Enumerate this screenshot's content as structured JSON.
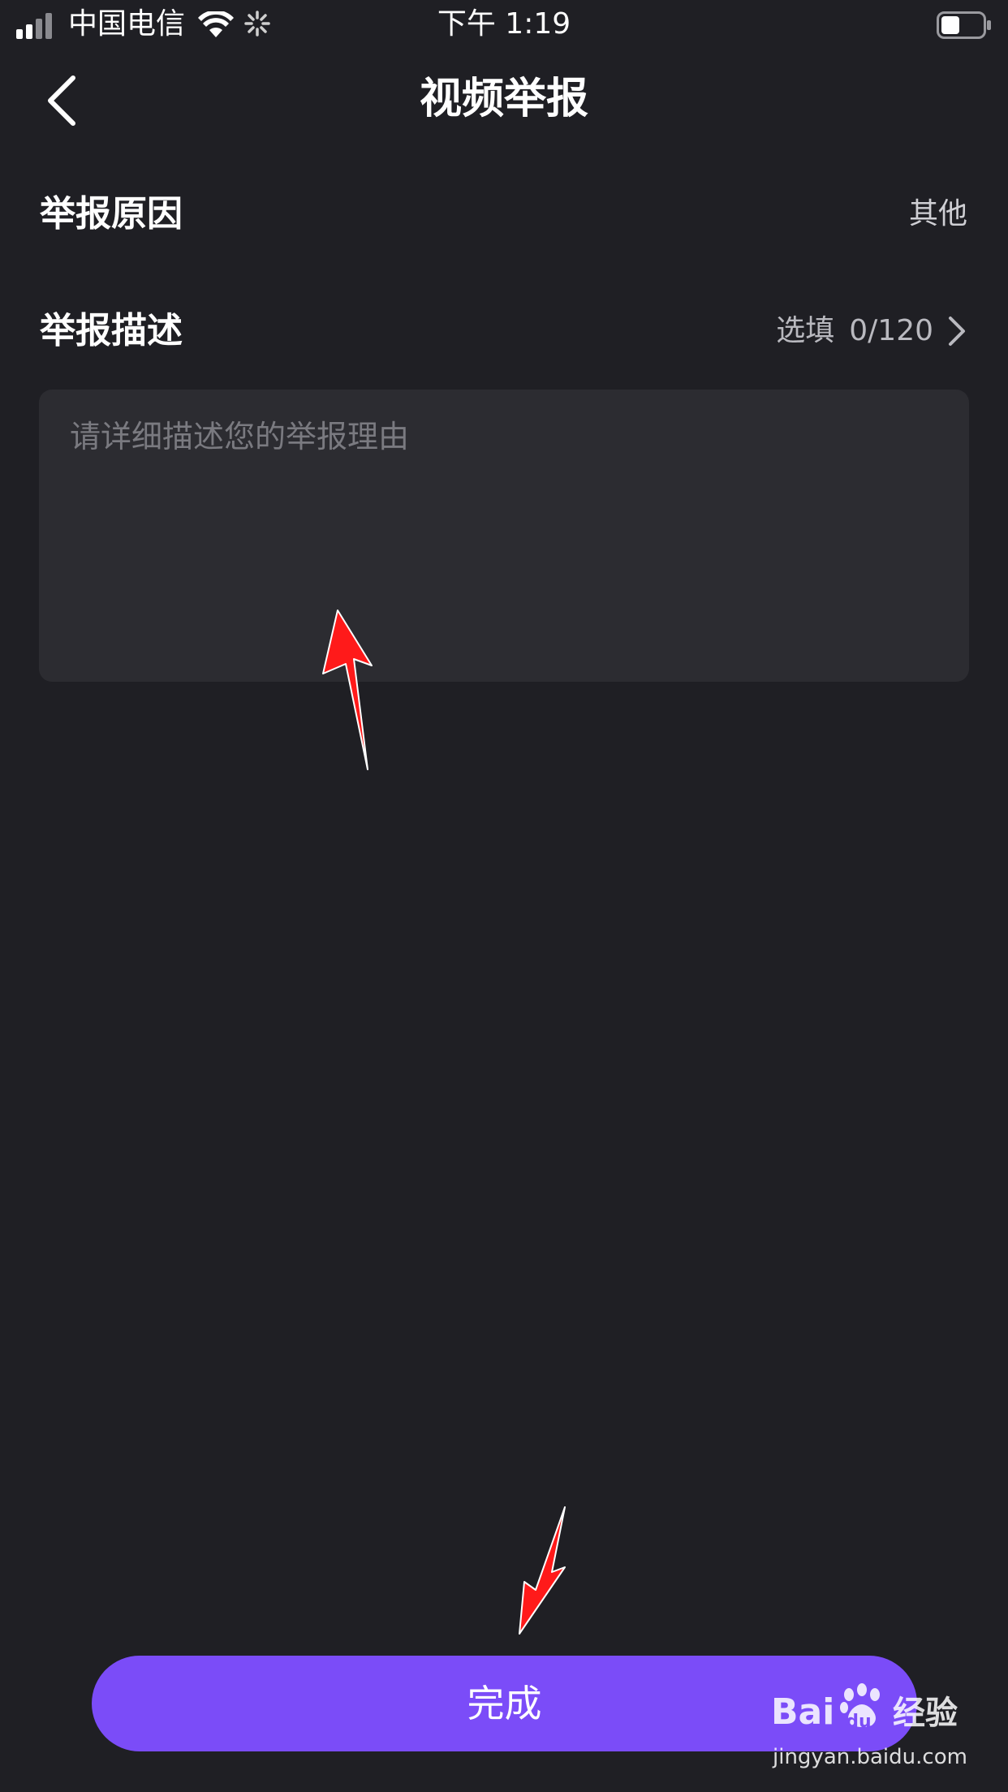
{
  "status_bar": {
    "carrier": "中国电信",
    "time": "下午 1:19",
    "icons": [
      "signal-icon",
      "wifi-icon",
      "activity-icon",
      "battery-icon"
    ]
  },
  "nav": {
    "title": "视频举报",
    "back_icon": "chevron-left-icon"
  },
  "reason_row": {
    "label": "举报原因",
    "value": "其他"
  },
  "description_row": {
    "label": "举报描述",
    "optional_label": "选填",
    "counter": "0/120",
    "chevron_icon": "chevron-right-icon"
  },
  "description_input": {
    "placeholder": "请详细描述您的举报理由",
    "value": ""
  },
  "done_button": {
    "label": "完成"
  },
  "watermark": {
    "logo": "Bai du 经验",
    "url": "jingyan.baidu.com"
  },
  "colors": {
    "background": "#1f1f24",
    "input_background": "#2c2c31",
    "accent": "#7b4cf8",
    "annotation_arrow": "#ff0000"
  }
}
